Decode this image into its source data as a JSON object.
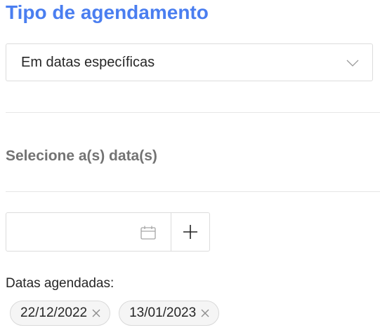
{
  "header": {
    "title": "Tipo de agendamento"
  },
  "schedule_type": {
    "selected": "Em datas específicas"
  },
  "date_picker": {
    "section_label": "Selecione a(s) data(s)",
    "input_value": "",
    "placeholder": ""
  },
  "scheduled": {
    "label": "Datas agendadas:",
    "dates": [
      {
        "label": "22/12/2022"
      },
      {
        "label": "13/01/2023"
      }
    ]
  },
  "icons": {
    "select": "chevron-down-icon",
    "date_input": "calendar-icon",
    "add": "plus-icon",
    "chip_remove": "close-icon"
  },
  "colors": {
    "title": "#4a7ef0",
    "section_label": "#737373",
    "chip_background": "#f5f5f5",
    "border": "#dcdcdc"
  }
}
